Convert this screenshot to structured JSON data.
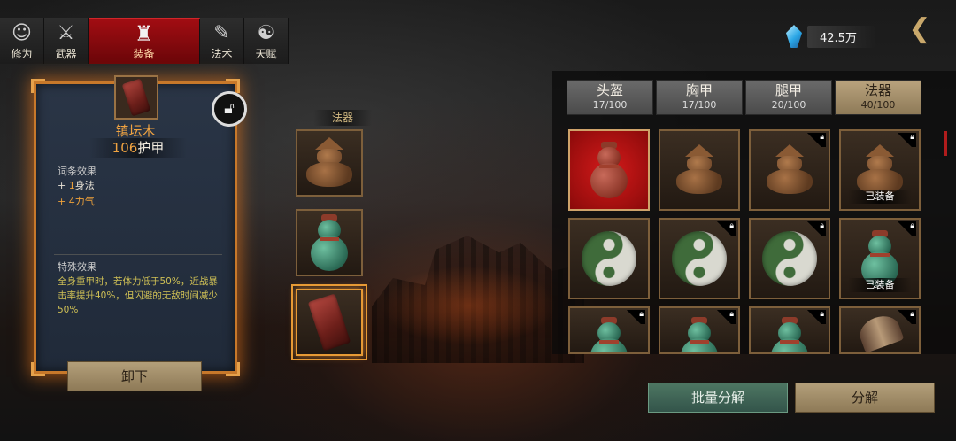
{
  "nav": {
    "tabs": [
      {
        "label": "修为",
        "icon": "cultivation-icon"
      },
      {
        "label": "武器",
        "icon": "weapon-icon"
      },
      {
        "label": "装备",
        "icon": "equipment-icon",
        "active": true
      },
      {
        "label": "法术",
        "icon": "spell-icon"
      },
      {
        "label": "天赋",
        "icon": "talent-icon"
      }
    ]
  },
  "currency": {
    "amount": "42.5万",
    "icon": "spirit-crystal-icon"
  },
  "item": {
    "name": "镇坛木",
    "armor_value": "106",
    "armor_label": "护甲",
    "affix_title": "词条效果",
    "stats": [
      {
        "prefix": "+ ",
        "value": "1",
        "name": "身法"
      },
      {
        "prefix": "+ 4",
        "value": "",
        "name": "力气"
      }
    ],
    "special_title": "特殊效果",
    "special_text": "全身重甲时，若体力低于50%，近战暴击率提升40%，但闪避的无敌时间减少50%",
    "unequip_label": "卸下"
  },
  "slots": {
    "label": "法器",
    "items": [
      "pagoda-urn",
      "jade-gourd",
      "zhentan-wood"
    ]
  },
  "inventory": {
    "tabs": [
      {
        "label": "头盔",
        "count": "17/100"
      },
      {
        "label": "胸甲",
        "count": "17/100"
      },
      {
        "label": "腿甲",
        "count": "20/100"
      },
      {
        "label": "法器",
        "count": "40/100",
        "active": true
      }
    ],
    "equipped_label": "已装备"
  },
  "actions": {
    "bulk_decompose": "批量分解",
    "decompose": "分解"
  },
  "colors": {
    "accent_orange": "#e79a35",
    "active_tab_red": "#a10d12",
    "gold_text": "#f0a341",
    "jade_button": "#4d7662"
  }
}
